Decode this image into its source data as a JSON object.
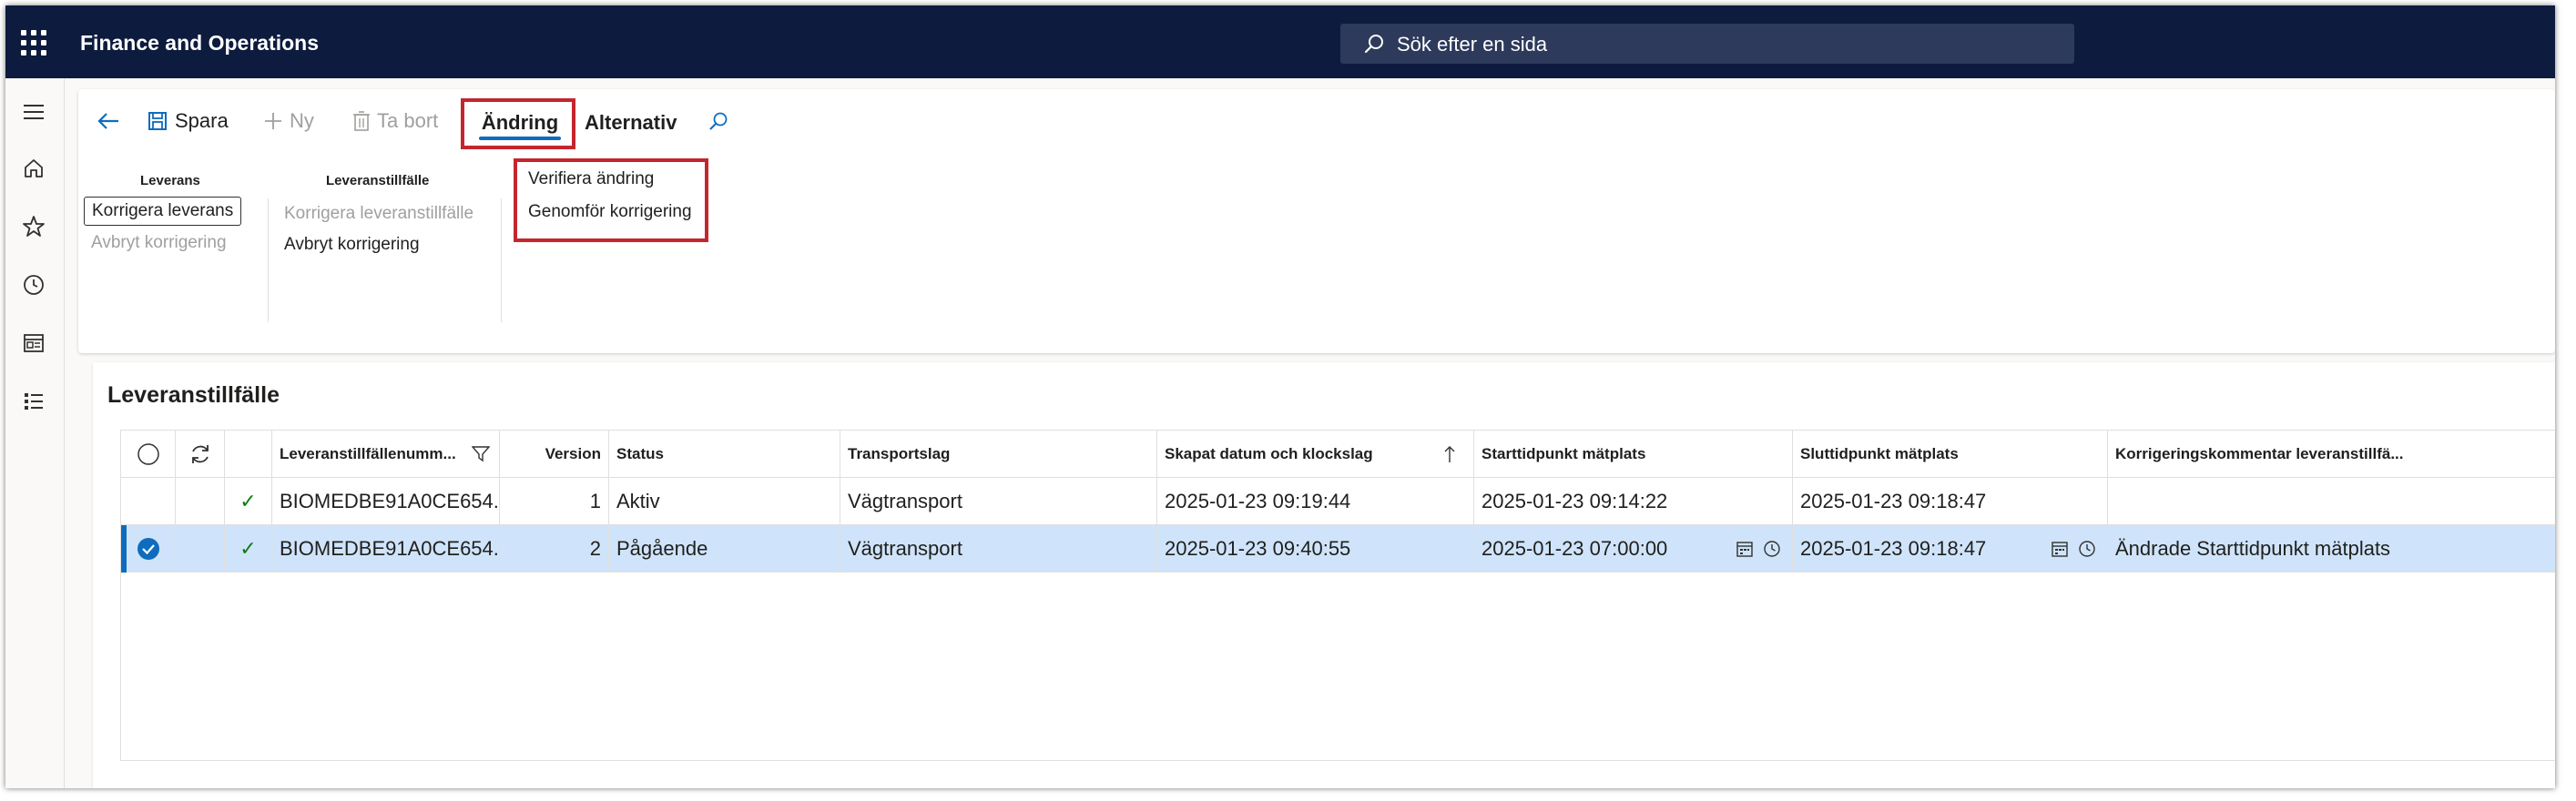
{
  "app": {
    "title": "Finance and Operations"
  },
  "search": {
    "placeholder": "Sök efter en sida"
  },
  "toolbar": {
    "save_label": "Spara",
    "new_label": "Ny",
    "delete_label": "Ta bort",
    "tab_aendring": "Ändring",
    "tab_alternativ": "Alternativ"
  },
  "ribbon": {
    "group_leverans": {
      "title": "Leverans",
      "correct_button": "Korrigera leverans",
      "cancel_button": "Avbryt korrigering"
    },
    "group_leveranstillfalle": {
      "title": "Leveranstillfälle",
      "correct_button": "Korrigera leveranstillfälle",
      "cancel_button": "Avbryt korrigering"
    },
    "group_actions": {
      "verify_button": "Verifiera ändring",
      "execute_button": "Genomför korrigering"
    }
  },
  "grid": {
    "title": "Leveranstillfälle",
    "columns": {
      "id": "Leveranstillfällenumm...",
      "version": "Version",
      "status": "Status",
      "transport": "Transportslag",
      "created": "Skapat datum och klockslag",
      "start": "Starttidpunkt mätplats",
      "end": "Sluttidpunkt mätplats",
      "comment": "Korrigeringskommentar leveranstillfä..."
    },
    "rows": [
      {
        "check": "✓",
        "id": "BIOMEDBE91A0CE654...",
        "version": "1",
        "status": "Aktiv",
        "transport": "Vägtransport",
        "created": "2025-01-23 09:19:44",
        "start": "2025-01-23 09:14:22",
        "end": "2025-01-23 09:18:47",
        "comment": ""
      },
      {
        "check": "✓",
        "id": "BIOMEDBE91A0CE654...",
        "version": "2",
        "status": "Pågående",
        "transport": "Vägtransport",
        "created": "2025-01-23 09:40:55",
        "start": "2025-01-23 07:00:00",
        "end": "2025-01-23 09:18:47",
        "comment": "Ändrade Starttidpunkt mätplats"
      }
    ]
  },
  "colors": {
    "topbar": "#0d1b3e",
    "accent": "#0f6cbd",
    "highlight_box": "#c4262e",
    "selected_row": "#cfe4fa",
    "check": "#107c10"
  },
  "icons": [
    "waffle-icon",
    "search-icon",
    "hamburger-icon",
    "home-icon",
    "star-icon",
    "clock-icon",
    "workspace-icon",
    "list-icon",
    "back-arrow-icon",
    "save-icon",
    "plus-icon",
    "delete-icon",
    "filter-icon",
    "refresh-icon",
    "checkmark-icon",
    "sort-ascending-icon",
    "calendar-icon"
  ]
}
